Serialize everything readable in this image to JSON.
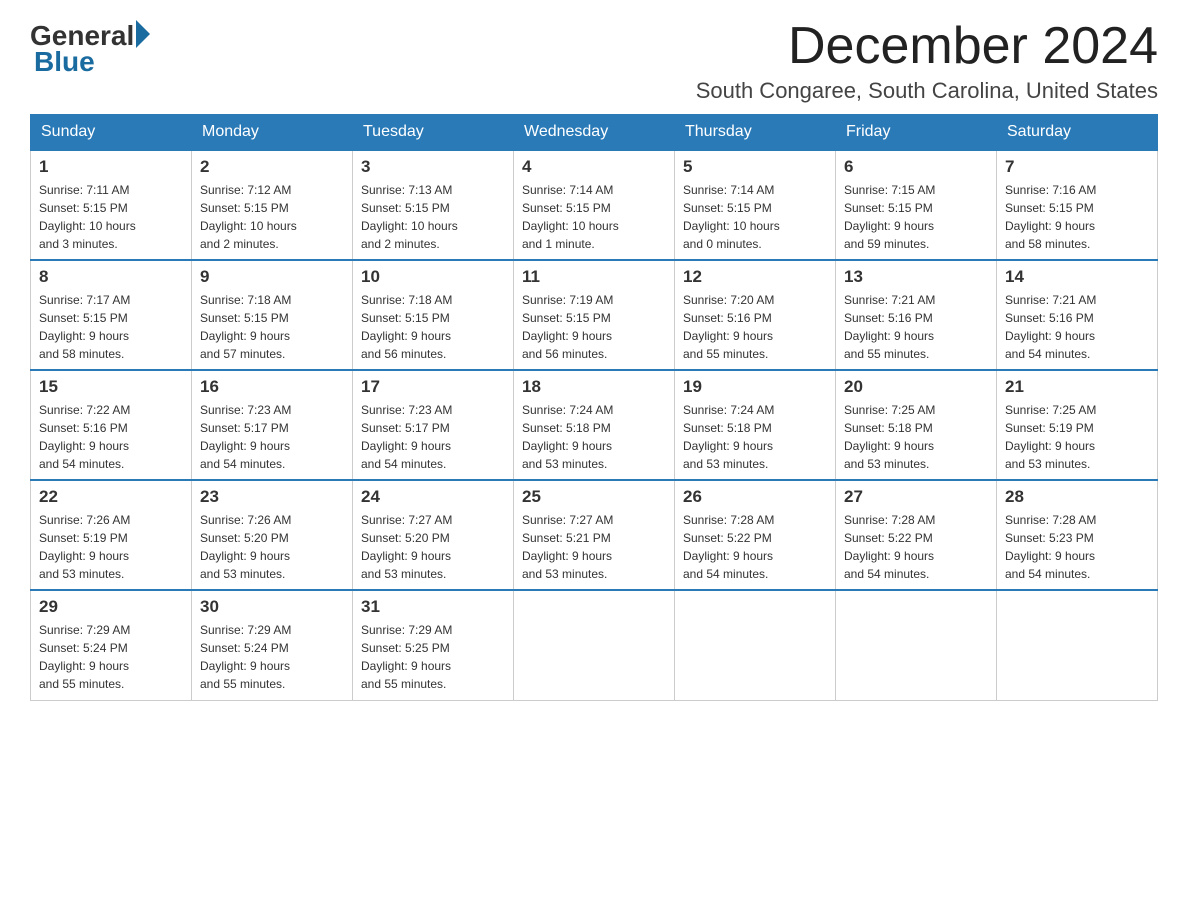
{
  "logo": {
    "general": "General",
    "blue": "Blue"
  },
  "header": {
    "month_title": "December 2024",
    "location": "South Congaree, South Carolina, United States"
  },
  "weekdays": [
    "Sunday",
    "Monday",
    "Tuesday",
    "Wednesday",
    "Thursday",
    "Friday",
    "Saturday"
  ],
  "weeks": [
    [
      {
        "day": "1",
        "sunrise": "7:11 AM",
        "sunset": "5:15 PM",
        "daylight": "10 hours and 3 minutes."
      },
      {
        "day": "2",
        "sunrise": "7:12 AM",
        "sunset": "5:15 PM",
        "daylight": "10 hours and 2 minutes."
      },
      {
        "day": "3",
        "sunrise": "7:13 AM",
        "sunset": "5:15 PM",
        "daylight": "10 hours and 2 minutes."
      },
      {
        "day": "4",
        "sunrise": "7:14 AM",
        "sunset": "5:15 PM",
        "daylight": "10 hours and 1 minute."
      },
      {
        "day": "5",
        "sunrise": "7:14 AM",
        "sunset": "5:15 PM",
        "daylight": "10 hours and 0 minutes."
      },
      {
        "day": "6",
        "sunrise": "7:15 AM",
        "sunset": "5:15 PM",
        "daylight": "9 hours and 59 minutes."
      },
      {
        "day": "7",
        "sunrise": "7:16 AM",
        "sunset": "5:15 PM",
        "daylight": "9 hours and 58 minutes."
      }
    ],
    [
      {
        "day": "8",
        "sunrise": "7:17 AM",
        "sunset": "5:15 PM",
        "daylight": "9 hours and 58 minutes."
      },
      {
        "day": "9",
        "sunrise": "7:18 AM",
        "sunset": "5:15 PM",
        "daylight": "9 hours and 57 minutes."
      },
      {
        "day": "10",
        "sunrise": "7:18 AM",
        "sunset": "5:15 PM",
        "daylight": "9 hours and 56 minutes."
      },
      {
        "day": "11",
        "sunrise": "7:19 AM",
        "sunset": "5:15 PM",
        "daylight": "9 hours and 56 minutes."
      },
      {
        "day": "12",
        "sunrise": "7:20 AM",
        "sunset": "5:16 PM",
        "daylight": "9 hours and 55 minutes."
      },
      {
        "day": "13",
        "sunrise": "7:21 AM",
        "sunset": "5:16 PM",
        "daylight": "9 hours and 55 minutes."
      },
      {
        "day": "14",
        "sunrise": "7:21 AM",
        "sunset": "5:16 PM",
        "daylight": "9 hours and 54 minutes."
      }
    ],
    [
      {
        "day": "15",
        "sunrise": "7:22 AM",
        "sunset": "5:16 PM",
        "daylight": "9 hours and 54 minutes."
      },
      {
        "day": "16",
        "sunrise": "7:23 AM",
        "sunset": "5:17 PM",
        "daylight": "9 hours and 54 minutes."
      },
      {
        "day": "17",
        "sunrise": "7:23 AM",
        "sunset": "5:17 PM",
        "daylight": "9 hours and 54 minutes."
      },
      {
        "day": "18",
        "sunrise": "7:24 AM",
        "sunset": "5:18 PM",
        "daylight": "9 hours and 53 minutes."
      },
      {
        "day": "19",
        "sunrise": "7:24 AM",
        "sunset": "5:18 PM",
        "daylight": "9 hours and 53 minutes."
      },
      {
        "day": "20",
        "sunrise": "7:25 AM",
        "sunset": "5:18 PM",
        "daylight": "9 hours and 53 minutes."
      },
      {
        "day": "21",
        "sunrise": "7:25 AM",
        "sunset": "5:19 PM",
        "daylight": "9 hours and 53 minutes."
      }
    ],
    [
      {
        "day": "22",
        "sunrise": "7:26 AM",
        "sunset": "5:19 PM",
        "daylight": "9 hours and 53 minutes."
      },
      {
        "day": "23",
        "sunrise": "7:26 AM",
        "sunset": "5:20 PM",
        "daylight": "9 hours and 53 minutes."
      },
      {
        "day": "24",
        "sunrise": "7:27 AM",
        "sunset": "5:20 PM",
        "daylight": "9 hours and 53 minutes."
      },
      {
        "day": "25",
        "sunrise": "7:27 AM",
        "sunset": "5:21 PM",
        "daylight": "9 hours and 53 minutes."
      },
      {
        "day": "26",
        "sunrise": "7:28 AM",
        "sunset": "5:22 PM",
        "daylight": "9 hours and 54 minutes."
      },
      {
        "day": "27",
        "sunrise": "7:28 AM",
        "sunset": "5:22 PM",
        "daylight": "9 hours and 54 minutes."
      },
      {
        "day": "28",
        "sunrise": "7:28 AM",
        "sunset": "5:23 PM",
        "daylight": "9 hours and 54 minutes."
      }
    ],
    [
      {
        "day": "29",
        "sunrise": "7:29 AM",
        "sunset": "5:24 PM",
        "daylight": "9 hours and 55 minutes."
      },
      {
        "day": "30",
        "sunrise": "7:29 AM",
        "sunset": "5:24 PM",
        "daylight": "9 hours and 55 minutes."
      },
      {
        "day": "31",
        "sunrise": "7:29 AM",
        "sunset": "5:25 PM",
        "daylight": "9 hours and 55 minutes."
      },
      null,
      null,
      null,
      null
    ]
  ],
  "labels": {
    "sunrise": "Sunrise:",
    "sunset": "Sunset:",
    "daylight": "Daylight:"
  }
}
